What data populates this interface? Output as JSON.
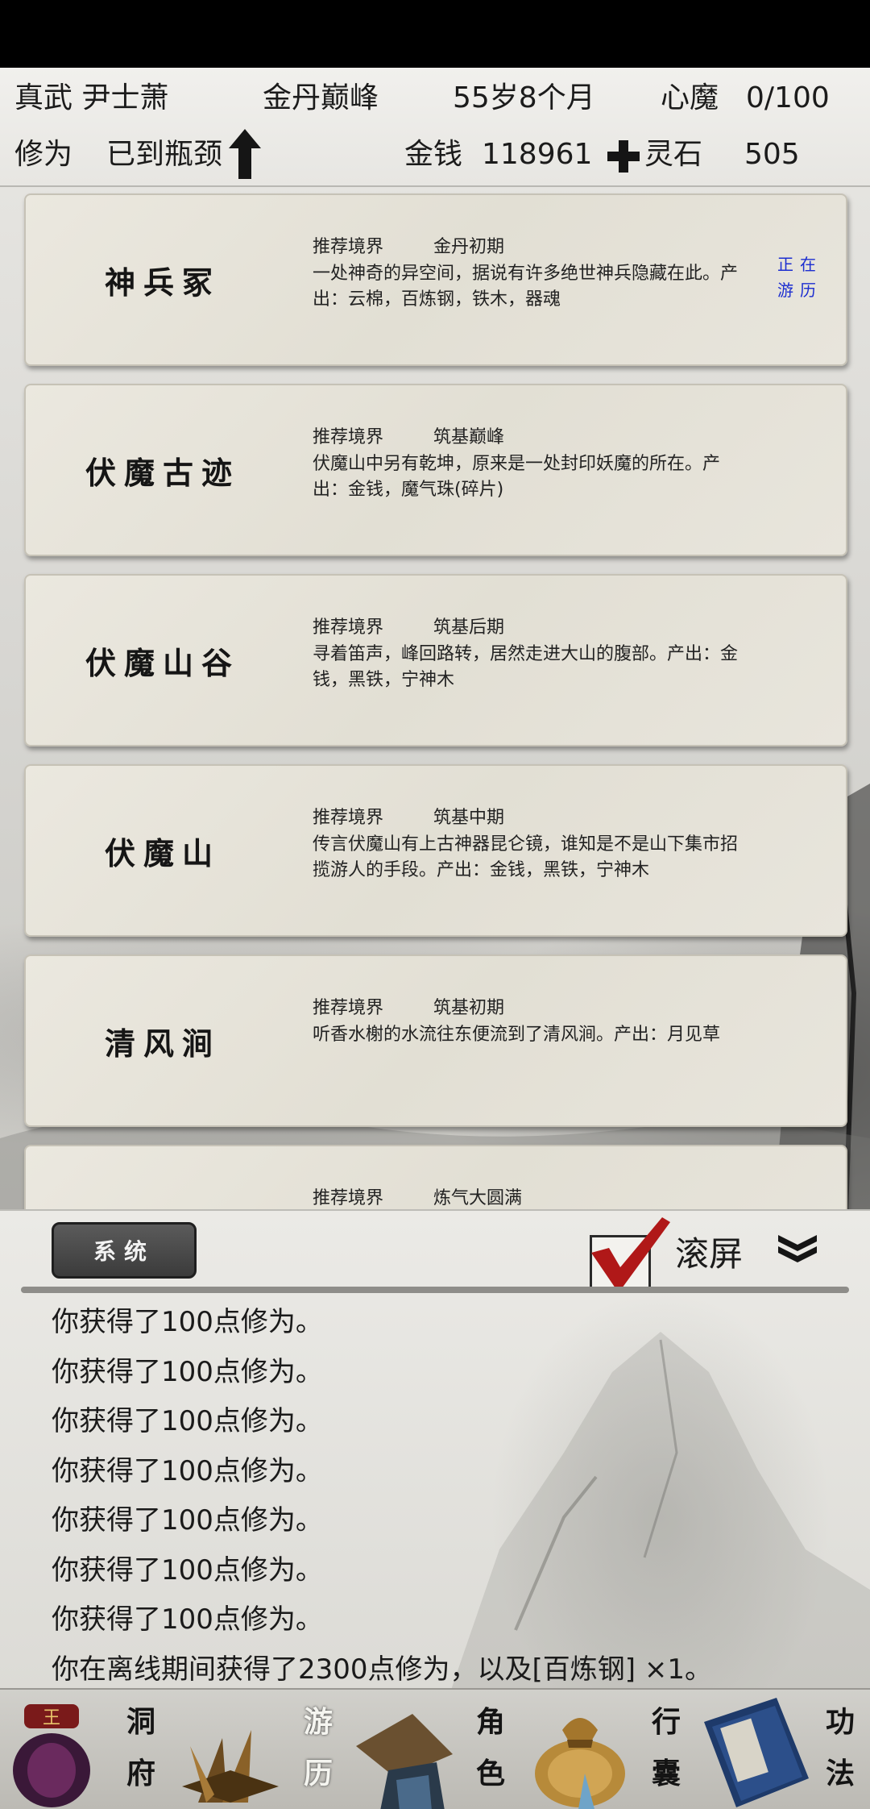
{
  "header": {
    "title_name": "真武 尹士萧",
    "realm": "金丹巅峰",
    "age": "55岁8个月",
    "demon_label": "心魔",
    "demon_value": "0/100",
    "cultivation_label": "修为",
    "cultivation_status": "已到瓶颈",
    "money_label": "金钱",
    "money_value": "118961",
    "spirit_stone_label": "灵石",
    "spirit_stone_value": "505"
  },
  "locations": [
    {
      "name": "神兵冢",
      "rec_label": "推荐境界",
      "rec_value": "金丹初期",
      "desc": "一处神奇的异空间，据说有许多绝世神兵隐藏在此。产出：云棉，百炼钢，铁木，器魂",
      "status": "正在游历"
    },
    {
      "name": "伏魔古迹",
      "rec_label": "推荐境界",
      "rec_value": "筑基巅峰",
      "desc": "伏魔山中另有乾坤，原来是一处封印妖魔的所在。产出：金钱，魔气珠(碎片)",
      "status": ""
    },
    {
      "name": "伏魔山谷",
      "rec_label": "推荐境界",
      "rec_value": "筑基后期",
      "desc": "寻着笛声，峰回路转，居然走进大山的腹部。产出：金钱，黑铁，宁神木",
      "status": ""
    },
    {
      "name": "伏魔山",
      "rec_label": "推荐境界",
      "rec_value": "筑基中期",
      "desc": "传言伏魔山有上古神器昆仑镜，谁知是不是山下集市招揽游人的手段。产出：金钱，黑铁，宁神木",
      "status": ""
    },
    {
      "name": "清风涧",
      "rec_label": "推荐境界",
      "rec_value": "筑基初期",
      "desc": "听香水榭的水流往东便流到了清风涧。产出：月见草",
      "status": ""
    },
    {
      "name": "",
      "rec_label": "推荐境界",
      "rec_value": "炼气大圆满",
      "desc": "",
      "status": ""
    }
  ],
  "log": {
    "tab_label": "系统",
    "scroll_label": "滚屏",
    "scroll_checked": true,
    "lines": [
      "你获得了100点修为。",
      "你获得了100点修为。",
      "你获得了100点修为。",
      "你获得了100点修为。",
      "你获得了100点修为。",
      "你获得了100点修为。",
      "你获得了100点修为。",
      "你在离线期间获得了2300点修为，以及[百炼钢]  ×1。"
    ]
  },
  "nav": {
    "items": [
      {
        "label_top": "洞",
        "label_bottom": "府",
        "icon": "cave-icon",
        "active": false
      },
      {
        "label_top": "游",
        "label_bottom": "历",
        "icon": "travel-icon",
        "active": true
      },
      {
        "label_top": "角",
        "label_bottom": "色",
        "icon": "character-icon",
        "active": false
      },
      {
        "label_top": "行",
        "label_bottom": "囊",
        "icon": "bag-icon",
        "active": false
      },
      {
        "label_top": "功",
        "label_bottom": "法",
        "icon": "book-icon",
        "active": false
      }
    ]
  },
  "colors": {
    "status_blue": "#1c2ed0",
    "check_red": "#b01818",
    "tab_dark": "#3b3b3b"
  }
}
